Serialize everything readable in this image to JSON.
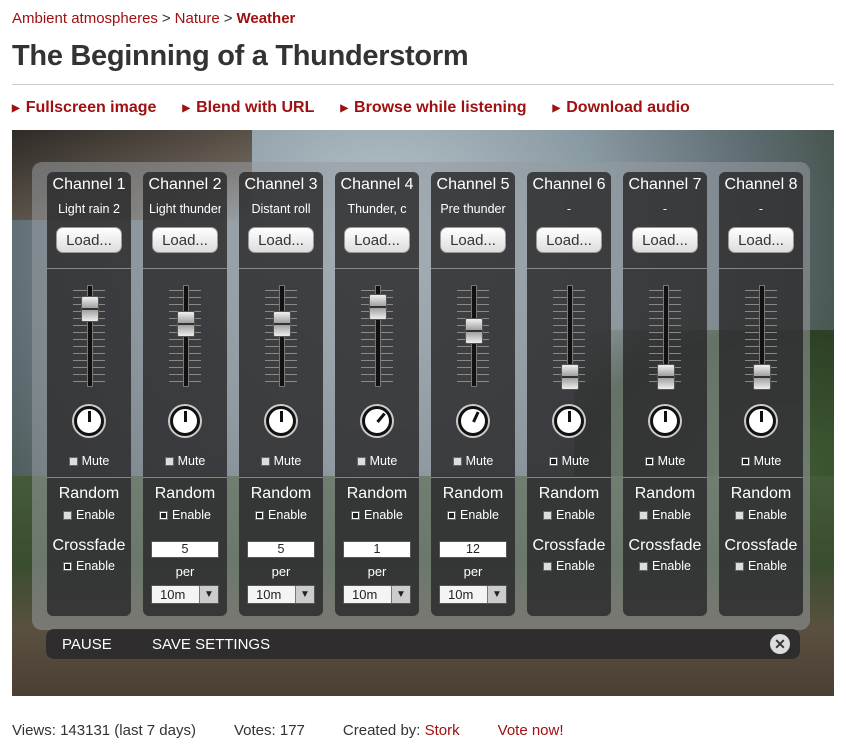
{
  "breadcrumb": {
    "items": [
      "Ambient atmospheres",
      "Nature"
    ],
    "separator": ">",
    "current": "Weather"
  },
  "page_title": "The Beginning of a Thunderstorm",
  "actions": [
    {
      "label": "Fullscreen image"
    },
    {
      "label": "Blend with URL"
    },
    {
      "label": "Browse while listening"
    },
    {
      "label": "Download audio"
    }
  ],
  "mixer": {
    "load_label": "Load...",
    "mute_label": "Mute",
    "random_label": "Random",
    "enable_label": "Enable",
    "crossfade_label": "Crossfade",
    "per_label": "per",
    "channels": [
      {
        "name": "Channel 1",
        "sound": "Light rain 2",
        "volume": 0.88,
        "knob_deg": 0,
        "mute": false,
        "random_enabled": false,
        "crossfade_enabled": true
      },
      {
        "name": "Channel 2",
        "sound": "Light thunder",
        "volume": 0.7,
        "knob_deg": 0,
        "mute": false,
        "random_enabled": true,
        "count": "5",
        "interval": "10m"
      },
      {
        "name": "Channel 3",
        "sound": "Distant roll",
        "volume": 0.7,
        "knob_deg": 0,
        "mute": false,
        "random_enabled": true,
        "count": "5",
        "interval": "10m"
      },
      {
        "name": "Channel 4",
        "sound": "Thunder, c",
        "volume": 0.9,
        "knob_deg": 40,
        "mute": false,
        "random_enabled": true,
        "count": "1",
        "interval": "10m"
      },
      {
        "name": "Channel 5",
        "sound": "Pre thunder",
        "volume": 0.62,
        "knob_deg": 25,
        "mute": false,
        "random_enabled": true,
        "count": "12",
        "interval": "10m"
      },
      {
        "name": "Channel 6",
        "sound": "-",
        "volume": 0.1,
        "knob_deg": 0,
        "mute": true,
        "random_enabled": false,
        "crossfade_enabled": false
      },
      {
        "name": "Channel 7",
        "sound": "-",
        "volume": 0.1,
        "knob_deg": 0,
        "mute": true,
        "random_enabled": false,
        "crossfade_enabled": false
      },
      {
        "name": "Channel 8",
        "sound": "-",
        "volume": 0.1,
        "knob_deg": 0,
        "mute": true,
        "random_enabled": false,
        "crossfade_enabled": false
      }
    ]
  },
  "bottom_bar": {
    "pause_label": "PAUSE",
    "save_label": "SAVE SETTINGS",
    "close_symbol": "✕"
  },
  "footer": {
    "views": "Views: 143131 (last 7 days)",
    "votes": "Votes: 177",
    "created_by_label": "Created by:",
    "author": "Stork",
    "vote_now": "Vote now!"
  },
  "colors": {
    "accent_red": "#a01010",
    "panel_dark": "#28282a"
  }
}
